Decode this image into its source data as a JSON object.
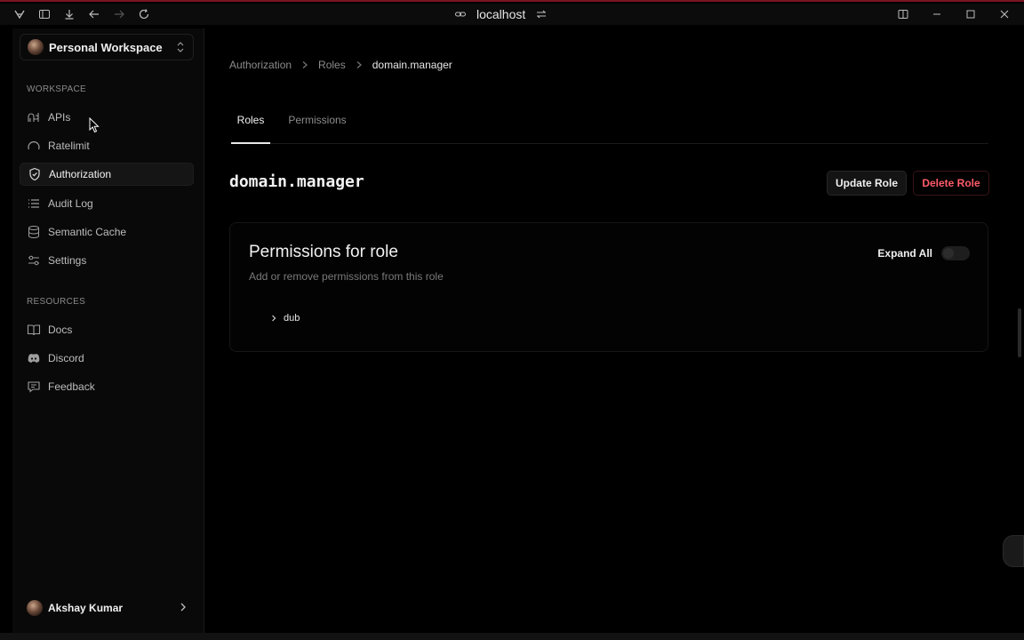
{
  "titlebar": {
    "url": "localhost"
  },
  "sidebar": {
    "workspace_name": "Personal Workspace",
    "section_workspace": "WORKSPACE",
    "section_resources": "RESOURCES",
    "items": [
      {
        "label": "APIs",
        "icon": "api-icon"
      },
      {
        "label": "Ratelimit",
        "icon": "gauge-icon"
      },
      {
        "label": "Authorization",
        "icon": "shield-icon",
        "active": true
      },
      {
        "label": "Audit Log",
        "icon": "list-icon"
      },
      {
        "label": "Semantic Cache",
        "icon": "database-icon"
      },
      {
        "label": "Settings",
        "icon": "sliders-icon"
      }
    ],
    "resources": [
      {
        "label": "Docs",
        "icon": "book-icon"
      },
      {
        "label": "Discord",
        "icon": "discord-icon"
      },
      {
        "label": "Feedback",
        "icon": "message-icon"
      }
    ],
    "user_name": "Akshay Kumar"
  },
  "main": {
    "breadcrumb": [
      "Authorization",
      "Roles",
      "domain.manager"
    ],
    "tabs": [
      {
        "label": "Roles",
        "active": true
      },
      {
        "label": "Permissions",
        "active": false
      }
    ],
    "role_name": "domain.manager",
    "update_label": "Update Role",
    "delete_label": "Delete Role",
    "card": {
      "title": "Permissions for role",
      "subtitle": "Add or remove permissions from this role",
      "expand_label": "Expand All",
      "expand_on": false,
      "permissions": [
        "dub"
      ]
    }
  },
  "colors": {
    "accent_danger": "#ff5c6a",
    "frame": "#7a1420"
  }
}
